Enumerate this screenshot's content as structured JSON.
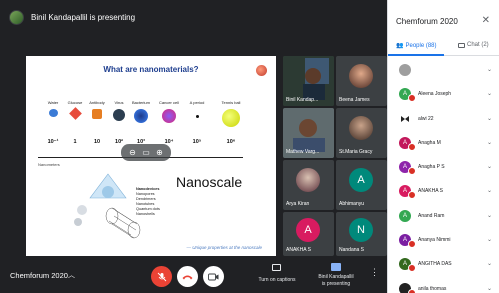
{
  "presenting": {
    "text": "Binil Kandapallil is presenting"
  },
  "slide": {
    "title": "What are nanomaterials?",
    "items": [
      {
        "label": "Water",
        "value": "10⁻¹"
      },
      {
        "label": "Glucose",
        "value": "1"
      },
      {
        "label": "Antibody",
        "value": "10"
      },
      {
        "label": "Virus",
        "value": "10²"
      },
      {
        "label": "Bacterium",
        "value": "10³"
      },
      {
        "label": "Cancer cell",
        "value": "10⁴"
      },
      {
        "label": "A period",
        "value": "10⁵"
      },
      {
        "label": "Tennis ball",
        "value": "10⁶"
      }
    ],
    "axis_label": "Nanometers",
    "big_label": "Nanoscale",
    "list_heading": "Nanodevices",
    "list_items": [
      "Nanopores",
      "Dendrimers",
      "Nanotubes",
      "Quantum dots",
      "Nanoshells"
    ],
    "caption": "— Unique properties at the nanoscale"
  },
  "tiles": [
    {
      "name": "Binil Kandap..."
    },
    {
      "name": "Beena James"
    },
    {
      "name": "Mathew Varg..."
    },
    {
      "name": "St.Maria Gracy"
    },
    {
      "name": "Arya Kiran"
    },
    {
      "name": "Abhimanyu",
      "initial": "A"
    },
    {
      "name": "ANAKHA S",
      "initial": "A"
    },
    {
      "name": "Nandana S",
      "initial": "N"
    }
  ],
  "bottom_bar": {
    "meeting_name": "Chemforum 2020",
    "captions_label": "Turn on captions",
    "presenting_label_1": "Binil Kandapallil",
    "presenting_label_2": "is presenting"
  },
  "panel": {
    "title": "Chemforum 2020",
    "people_tab": "People (88)",
    "chat_tab": "Chat (2)",
    "people": [
      {
        "name": "",
        "initial": "",
        "color": "#8e8e8e"
      },
      {
        "name": "Aleena Joseph",
        "initial": "A",
        "color": "#33a852"
      },
      {
        "name": "alwi 22",
        "initial": "",
        "color": "#6a3d9a"
      },
      {
        "name": "Anagha M",
        "initial": "A",
        "color": "#c2185b"
      },
      {
        "name": "Anagha P S",
        "initial": "A",
        "color": "#8e24aa"
      },
      {
        "name": "ANAKHA S",
        "initial": "A",
        "color": "#d81b60"
      },
      {
        "name": "Anand Ram",
        "initial": "A",
        "color": "#33a852"
      },
      {
        "name": "Ananya Nimmi",
        "initial": "A",
        "color": "#7b1fa2"
      },
      {
        "name": "ANGITHA DAS",
        "initial": "A",
        "color": "#33691e"
      },
      {
        "name": "anila thomas",
        "initial": "",
        "color": "#222222"
      }
    ]
  },
  "colors": {
    "accent": "#1a73e8",
    "end_call": "#ea4335",
    "mic_off": "#ea4335"
  }
}
